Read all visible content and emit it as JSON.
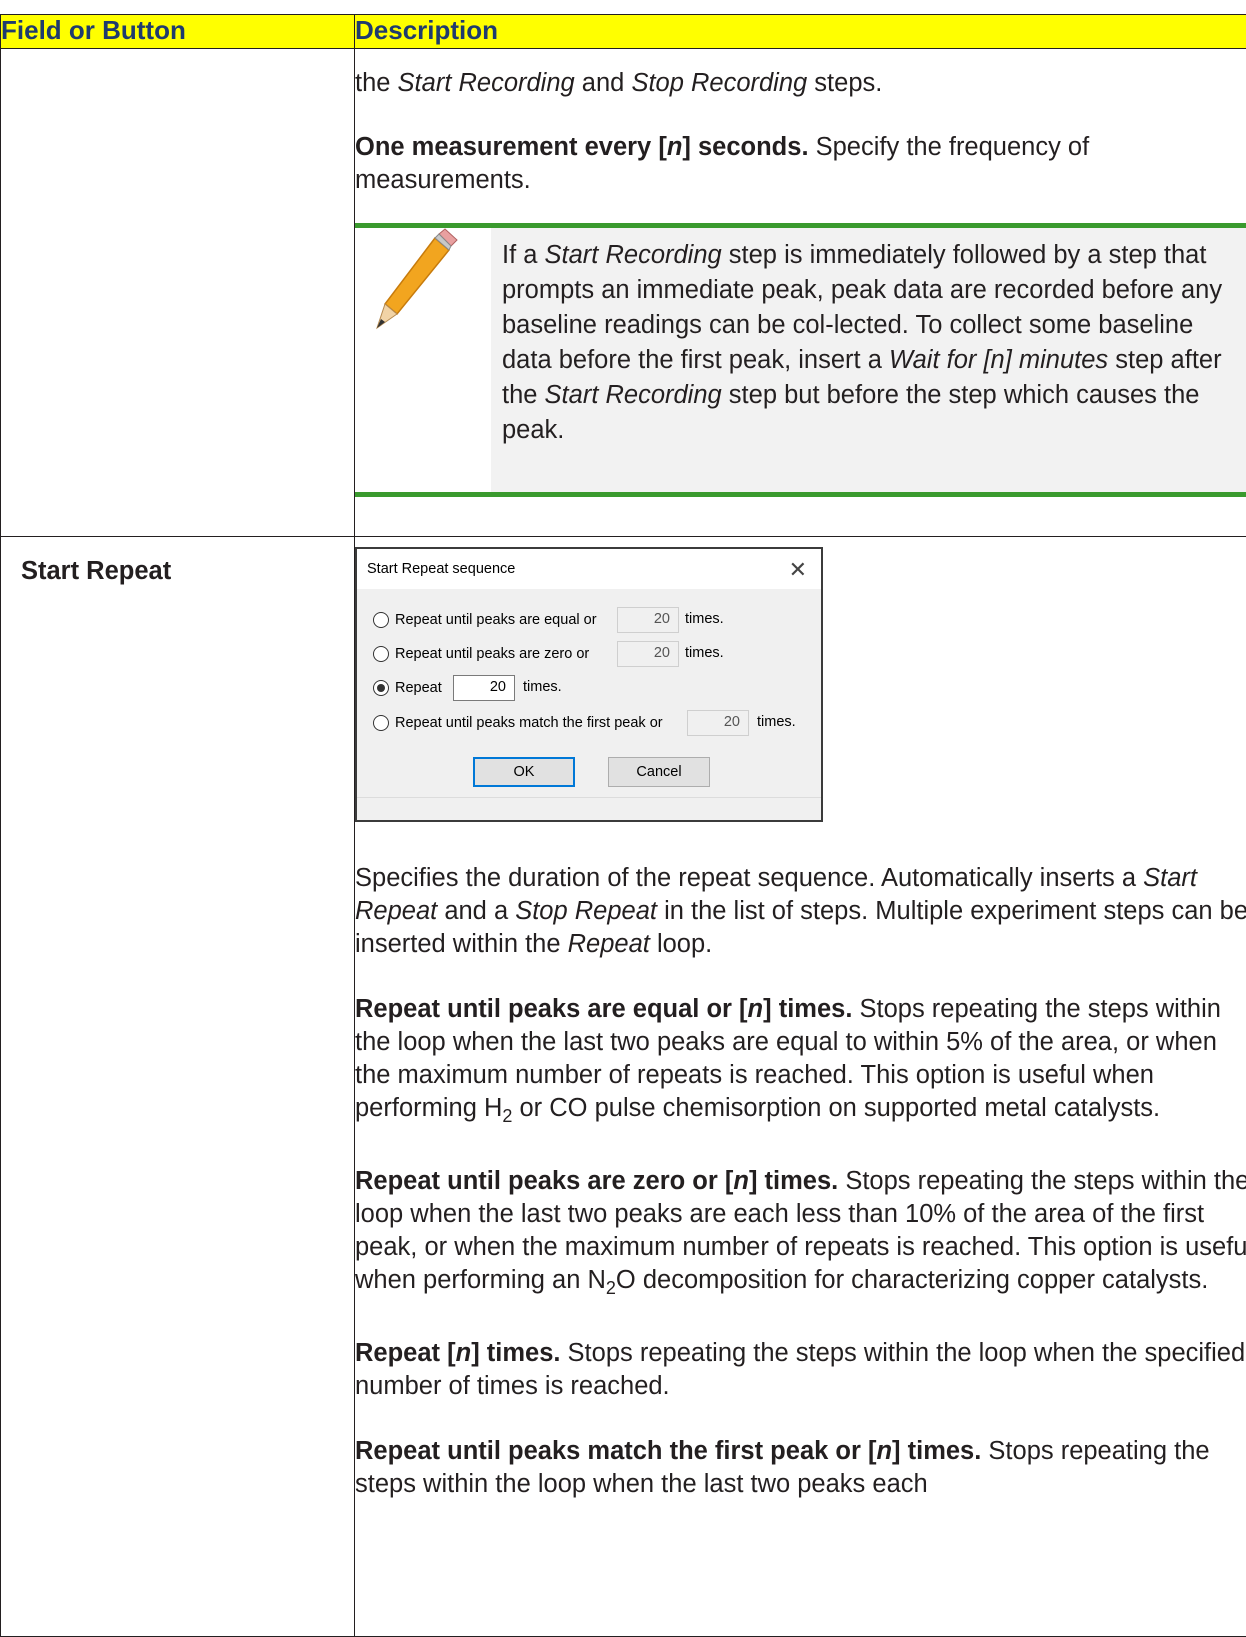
{
  "header": {
    "col1": "Field or Button",
    "col2": "Description"
  },
  "row1": {
    "intro_a": "the ",
    "intro_b": "Start Recording",
    "intro_c": " and ",
    "intro_d": "Stop Recording",
    "intro_e": " steps.",
    "measure_bold": "One measurement every [",
    "measure_n": "n",
    "measure_bold2": "] seconds.",
    "measure_rest": " Specify the frequency of measurements.",
    "note": {
      "a": "If a ",
      "b": "Start Recording",
      "c": " step is immediately followed by a step that prompts an immediate peak, peak data are recorded before any baseline readings can be col-lected. To collect some baseline data before the first peak, insert a ",
      "d": "Wait for [n] minutes",
      "e": " step after the ",
      "f": "Start Recording",
      "g": " step but before the step which causes the peak."
    }
  },
  "row2": {
    "label": "Start Repeat",
    "dialog": {
      "title": "Start Repeat sequence",
      "close": "✕",
      "opt1": "Repeat until peaks are equal or",
      "opt2": "Repeat until peaks are zero or",
      "opt3": "Repeat",
      "opt4": "Repeat until peaks match the first peak or",
      "val1": "20",
      "val2": "20",
      "val3": "20",
      "val4": "20",
      "times": "times.",
      "ok": "OK",
      "cancel": "Cancel"
    },
    "p1": {
      "a": "Specifies the duration of the repeat sequence. Automatically inserts a ",
      "b": "Start Repeat",
      "c": " and a ",
      "d": "Stop Repeat",
      "e": " in the list of steps. Multiple experiment steps can be inserted within the ",
      "f": "Repeat",
      "g": " loop."
    },
    "p2": {
      "bold1": "Repeat until peaks are equal or [",
      "n": "n",
      "bold2": "] times.",
      "a": " Stops repeating the steps within the loop when the last two peaks are equal to within 5% of the area, or when the maximum number of repeats is reached. This option is useful when performing H",
      "sub": "2",
      "b": " or CO pulse chemisorption on supported metal catalysts."
    },
    "p3": {
      "bold1": "Repeat until peaks are zero or [",
      "n": "n",
      "bold2": "] times.",
      "a": " Stops repeating the steps within the loop when the last two peaks are each less than 10% of the area of the first peak, or when the maximum number of repeats is reached. This option is useful when performing an N",
      "sub": "2",
      "b": "O decomposition for characterizing copper catalysts."
    },
    "p4": {
      "bold1": "Repeat [",
      "n": "n",
      "bold2": "] times.",
      "a": " Stops repeating the steps within the loop when the specified number of times is reached."
    },
    "p5": {
      "bold1": "Repeat until peaks match the first peak or [",
      "n": "n",
      "bold2": "] times.",
      "a": " Stops repeating the steps within the loop when the last two peaks each"
    }
  }
}
